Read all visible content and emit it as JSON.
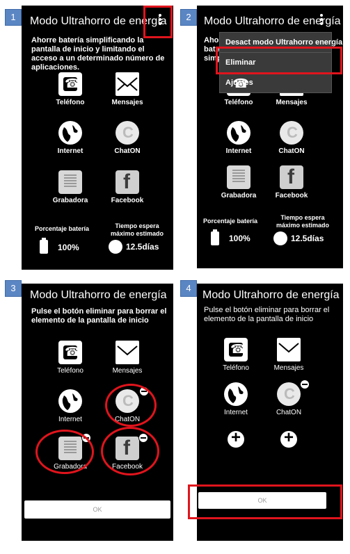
{
  "title": "Modo Ultrahorro de energía",
  "steps": [
    "1",
    "2",
    "3",
    "4"
  ],
  "panel1": {
    "description": "Ahorre batería simplificando la pantalla de inicio y limitando el acceso a un determinado número de aplicaciones.",
    "battery_label": "Porcentaje batería",
    "battery_value": "100%",
    "time_label": "Tiempo espera máximo estimado",
    "time_value": "12.5días"
  },
  "panel2": {
    "description_partial": "Ahorre batería simplificando la pantalla de inicio y limitando el acceso a un determinado número de aplicaciones.",
    "menu": [
      "Desact modo Ultrahorro energía",
      "Eliminar",
      "Ajustes"
    ],
    "battery_label": "Porcentaje batería",
    "battery_value": "100%",
    "time_label": "Tiempo espera máximo estimado",
    "time_value": "12.5días"
  },
  "panel3": {
    "description": "Pulse el botón eliminar para borrar el elemento de la pantalla de inicio",
    "ok": "OK"
  },
  "panel4": {
    "description": "Pulse el botón eliminar para borrar el elemento de la pantalla de inicio",
    "ok": "OK"
  },
  "apps": {
    "phone": "Teléfono",
    "messages": "Mensajes",
    "internet": "Internet",
    "chaton": "ChatON",
    "recorder": "Grabadora",
    "facebook": "Facebook"
  },
  "colors": {
    "highlight": "#e0141c",
    "step_badge": "#5b86c4"
  }
}
